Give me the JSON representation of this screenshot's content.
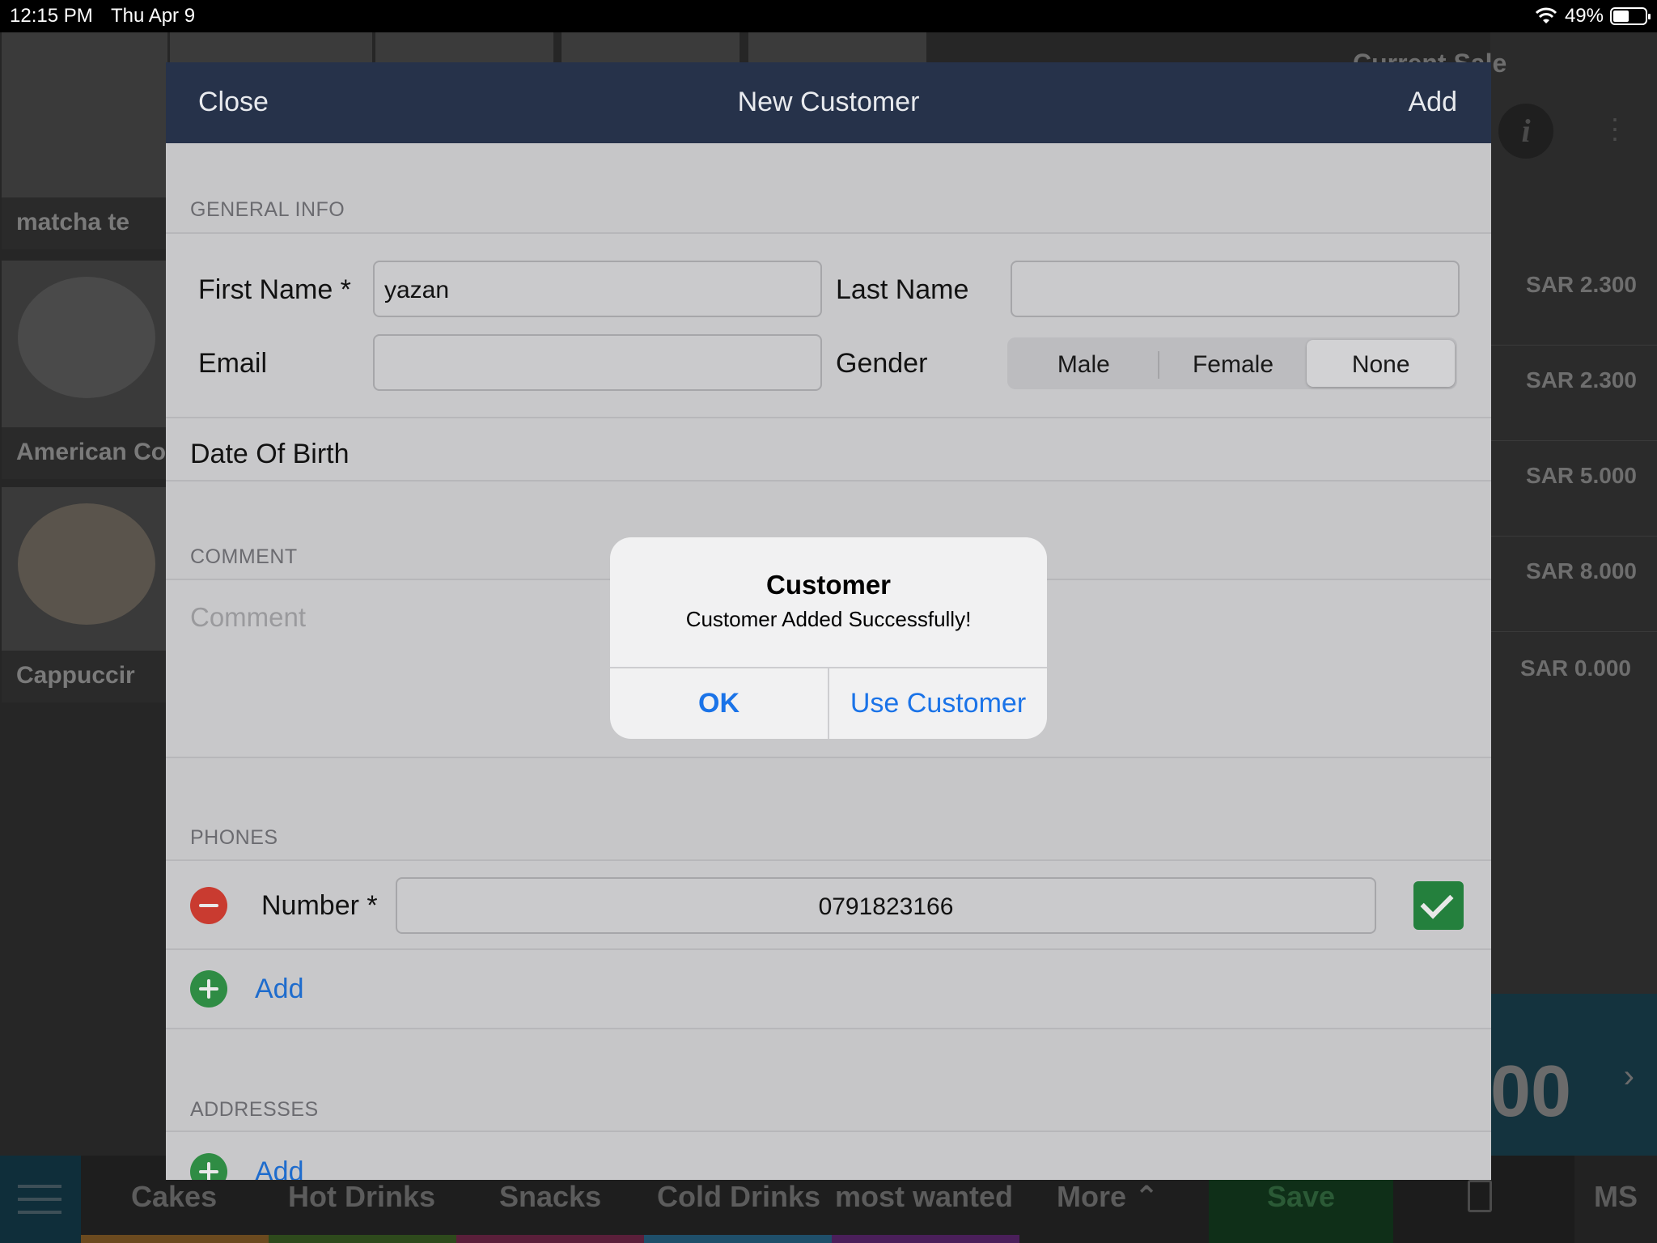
{
  "status_bar": {
    "time": "12:15 PM",
    "date": "Thu Apr 9",
    "battery": "49%",
    "battery_level": 0.49
  },
  "background": {
    "products": [
      {
        "name": "matcha te"
      },
      {
        "name": "American Co"
      },
      {
        "name": "Cappuccir"
      }
    ],
    "current_sale_title": "Current Sale",
    "prices": [
      "SAR 2.300",
      "SAR 2.300",
      "SAR 5.000",
      "SAR 8.000",
      "SAR 0.000"
    ],
    "total_fragment": "00",
    "info_glyph": "i",
    "categories": [
      "Cakes",
      "Hot Drinks",
      "Snacks",
      "Cold Drinks",
      "most wanted",
      "More"
    ],
    "category_colors": [
      "#6b4a1f",
      "#2e4a1c",
      "#5a1f3a",
      "#1f4f6a",
      "#4a1f5a"
    ],
    "save_label": "Save",
    "ms_label": "MS"
  },
  "sheet": {
    "close_label": "Close",
    "title": "New Customer",
    "add_label": "Add",
    "general_info": {
      "header": "GENERAL INFO",
      "first_name_label": "First Name *",
      "first_name_value": "yazan",
      "last_name_label": "Last Name",
      "last_name_value": "",
      "email_label": "Email",
      "email_value": "",
      "gender_label": "Gender",
      "gender_options": [
        "Male",
        "Female",
        "None"
      ],
      "gender_selected": "None"
    },
    "dob_label": "Date Of Birth",
    "comment": {
      "header": "COMMENT",
      "placeholder": "Comment"
    },
    "phones": {
      "header": "PHONES",
      "number_label": "Number *",
      "number_value": "0791823166",
      "add_label": "Add"
    },
    "addresses": {
      "header": "ADDRESSES",
      "add_label": "Add"
    }
  },
  "alert": {
    "title": "Customer",
    "message": "Customer Added Successfully!",
    "ok_label": "OK",
    "use_customer_label": "Use Customer"
  }
}
